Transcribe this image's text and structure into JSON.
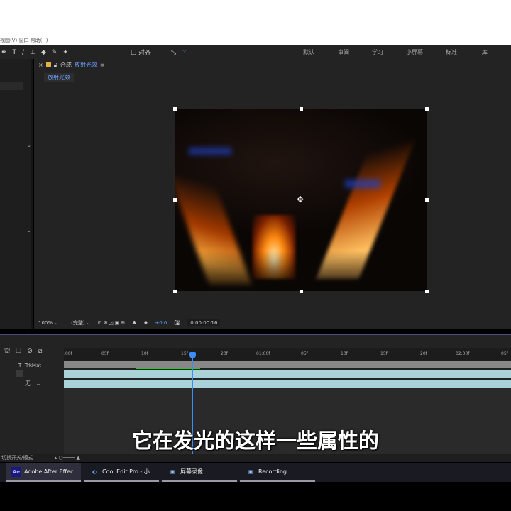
{
  "menu": "视图(V)  窗口  帮助(H)",
  "toolbar": {
    "align_label": "对齐"
  },
  "workspaces": [
    "默认",
    "审阅",
    "学习",
    "小屏幕",
    "标准",
    "库"
  ],
  "comp": {
    "prefix": "合成",
    "name": "放射光效",
    "subtab": "放射光效"
  },
  "viewer_bar": {
    "zoom": "100%",
    "resolution": "(完整)",
    "exposure": "+0.0",
    "timecode": "0:00:00:16"
  },
  "timeline": {
    "trkmat": "TrkMat",
    "t_label": "T",
    "none_option": "无",
    "ticks": [
      ":00f",
      "05f",
      "10f",
      "15f",
      "20f",
      "01:00f",
      "05f",
      "10f",
      "15f",
      "20f",
      "02:00f",
      "05f"
    ],
    "current_frame": 16
  },
  "subtitle": "它在发光的这样一些属性的",
  "status": "切换开关/模式",
  "taskbar": [
    {
      "icon": "Ae",
      "label": "Adobe After Effec..."
    },
    {
      "icon": "cool-edit-icon",
      "label": "Cool Edit Pro  - 小..."
    },
    {
      "icon": "recorder-icon",
      "label": "屏幕录像"
    },
    {
      "icon": "recorder-icon",
      "label": "Recording...."
    }
  ]
}
